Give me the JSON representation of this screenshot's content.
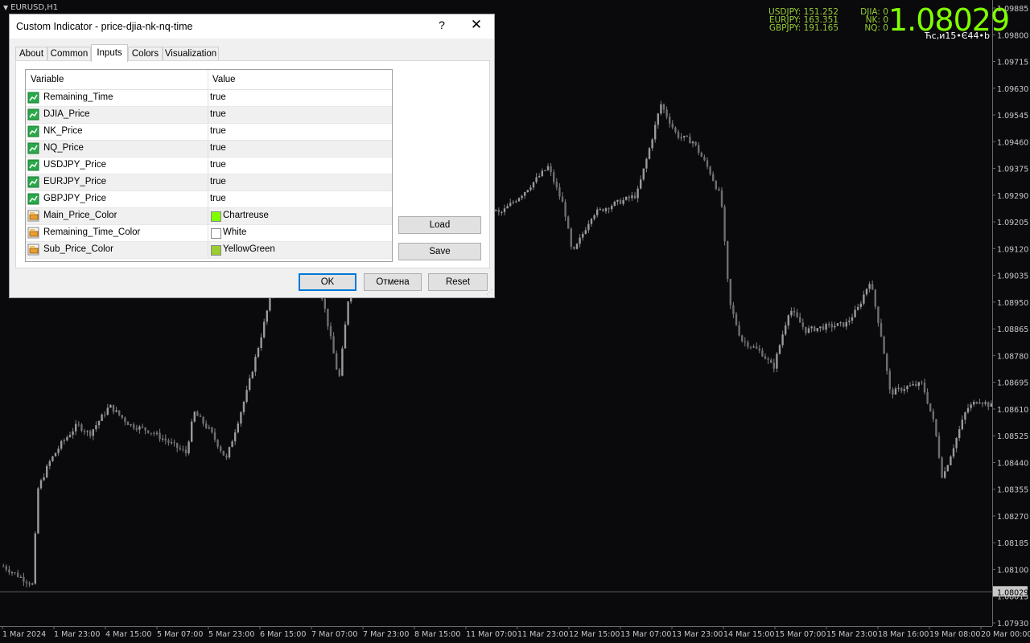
{
  "chart": {
    "symbol": "EURUSD,H1",
    "y_axis_labels": [
      "1.09885",
      "1.09800",
      "1.09715",
      "1.09630",
      "1.09545",
      "1.09460",
      "1.09375",
      "1.09290",
      "1.09205",
      "1.09120",
      "1.09035",
      "1.08950",
      "1.08865",
      "1.08780",
      "1.08695",
      "1.08610",
      "1.08525",
      "1.08440",
      "1.08355",
      "1.08270",
      "1.08185",
      "1.08100",
      "1.08015",
      "1.07930"
    ],
    "x_axis_labels": [
      "1 Mar 2024",
      "1 Mar 23:00",
      "4 Mar 15:00",
      "5 Mar 07:00",
      "5 Mar 23:00",
      "6 Mar 15:00",
      "7 Mar 07:00",
      "7 Mar 23:00",
      "8 Mar 15:00",
      "11 Mar 07:00",
      "11 Mar 23:00",
      "12 Mar 15:00",
      "13 Mar 07:00",
      "13 Mar 23:00",
      "14 Mar 15:00",
      "15 Mar 07:00",
      "15 Mar 23:00",
      "18 Mar 16:00",
      "19 Mar 08:00",
      "20 Mar 00:00"
    ],
    "current_price": "1.08029",
    "candle_color": "#808080",
    "background": "#0a0a0d"
  },
  "overlay": {
    "fx_lines": [
      "USDJPY: 151.252",
      "EURJPY: 163.351",
      "GBPJPY: 191.165"
    ],
    "index_lines": [
      "DJIA: 0",
      "NK: 0",
      "NQ: 0"
    ],
    "main_price": "1.08029",
    "remaining_time": "Ћс,и15•Є44•b",
    "main_color": "#7fff00",
    "sub_color": "#9acd32"
  },
  "dialog": {
    "title": "Custom Indicator - price-djia-nk-nq-time",
    "help": "?",
    "close": "✕",
    "tabs": [
      "About",
      "Common",
      "Inputs",
      "Colors",
      "Visualization"
    ],
    "active_tab": "Inputs",
    "columns": [
      "Variable",
      "Value"
    ],
    "rows": [
      {
        "name": "Remaining_Time",
        "value": "true"
      },
      {
        "name": "DJIA_Price",
        "value": "true"
      },
      {
        "name": "NK_Price",
        "value": "true"
      },
      {
        "name": "NQ_Price",
        "value": "true"
      },
      {
        "name": "USDJPY_Price",
        "value": "true"
      },
      {
        "name": "EURJPY_Price",
        "value": "true"
      },
      {
        "name": "GBPJPY_Price",
        "value": "true"
      },
      {
        "name": "Main_Price_Color",
        "value": "Chartreuse",
        "swatch": "#7fff00"
      },
      {
        "name": "Remaining_Time_Color",
        "value": "White",
        "swatch": "#ffffff"
      },
      {
        "name": "Sub_Price_Color",
        "value": "YellowGreen",
        "swatch": "#9acd32"
      }
    ],
    "load_label": "Load",
    "save_label": "Save",
    "ok_label": "OK",
    "cancel_label": "Отмена",
    "reset_label": "Reset"
  }
}
